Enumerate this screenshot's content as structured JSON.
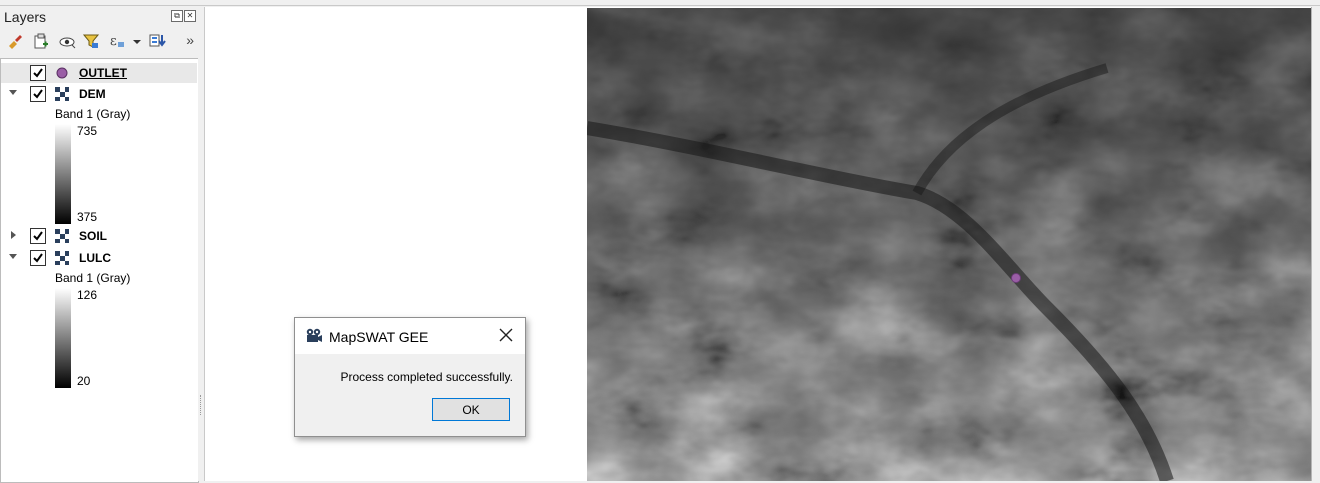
{
  "layers_panel": {
    "title": "Layers",
    "toolbar_icons": [
      "style-paint-icon",
      "add-group-icon",
      "visibility-eye-icon",
      "filter-icon",
      "expression-filter-icon",
      "move-to-bottom-icon"
    ],
    "more_label": "»",
    "layers": [
      {
        "name": "OUTLET",
        "checked": true,
        "type": "point",
        "expanded": null
      },
      {
        "name": "DEM",
        "checked": true,
        "type": "raster",
        "expanded": true,
        "band": "Band 1 (Gray)",
        "max": "735",
        "min": "375"
      },
      {
        "name": "SOIL",
        "checked": true,
        "type": "raster",
        "expanded": false
      },
      {
        "name": "LULC",
        "checked": true,
        "type": "raster",
        "expanded": true,
        "band": "Band 1 (Gray)",
        "max": "126",
        "min": "20"
      }
    ]
  },
  "dialog": {
    "title": "MapSWAT GEE",
    "message": "Process completed successfully.",
    "ok_label": "OK"
  },
  "colors": {
    "point_fill": "#9a5ea6",
    "dialog_border_accent": "#0078d7"
  }
}
